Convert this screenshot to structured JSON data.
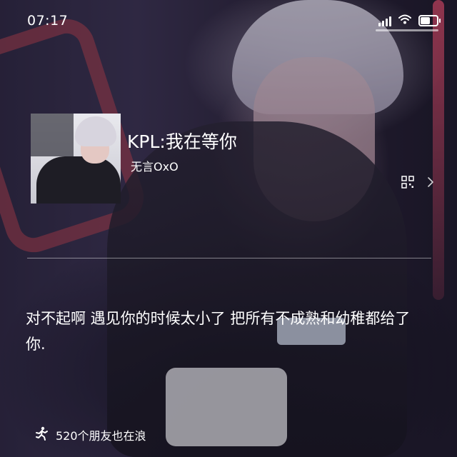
{
  "status_bar": {
    "time": "07:17",
    "signal_icon": "signal-bars-icon",
    "wifi_icon": "wifi-icon",
    "battery_icon": "battery-icon",
    "battery_level": 0.65
  },
  "song": {
    "title": "KPL:我在等你",
    "artist": "无言OxO",
    "qr_icon": "qr-code-icon",
    "chevron_icon": "chevron-right-icon"
  },
  "comment": {
    "text": "对不起啊 遇见你的时候太小了 把所有不成熟和幼稚都给了你."
  },
  "listeners": {
    "icon": "running-person-icon",
    "label": "520个朋友也在浪"
  }
}
